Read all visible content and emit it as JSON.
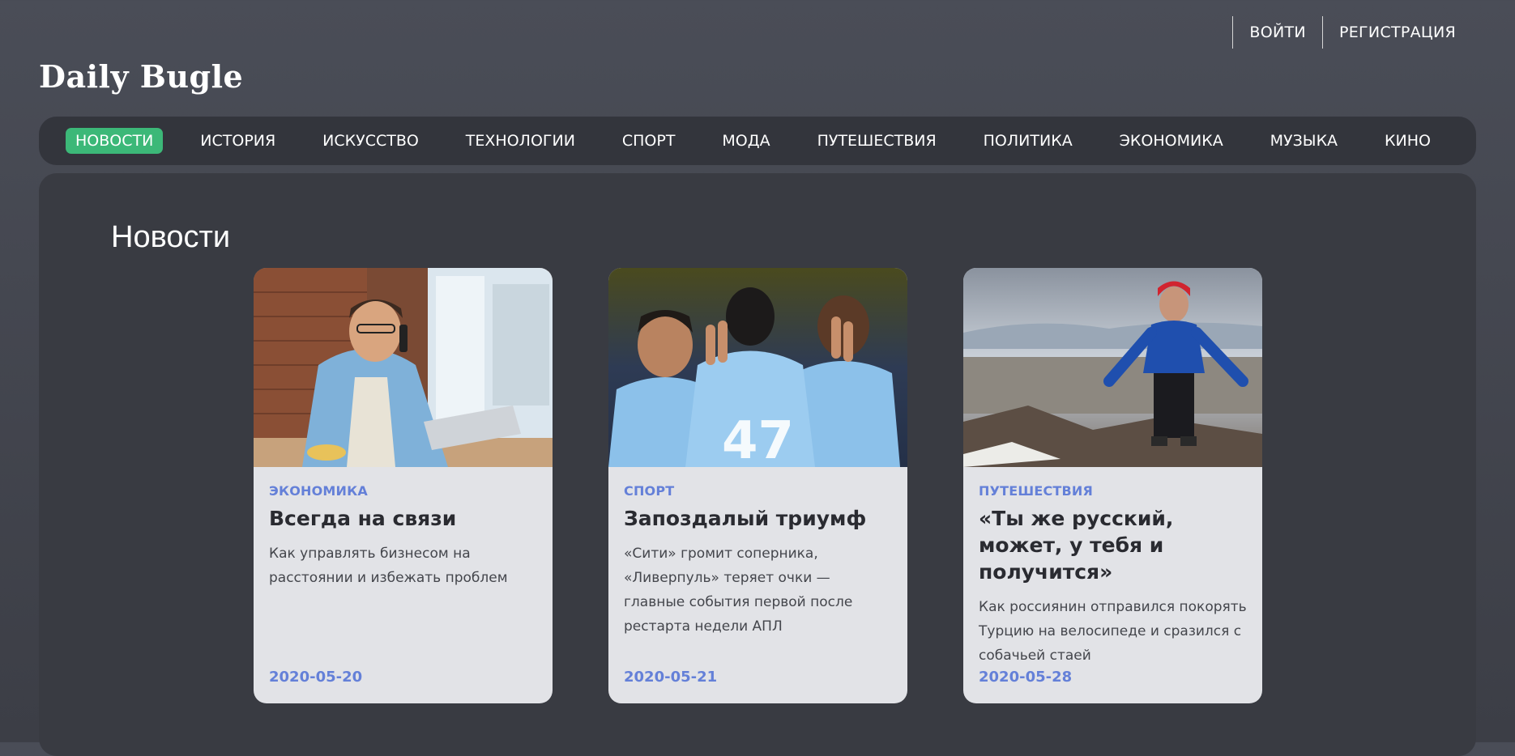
{
  "header": {
    "logo": "Daily Bugle",
    "login_label": "ВОЙТИ",
    "register_label": "РЕГИСТРАЦИЯ"
  },
  "nav": {
    "items": [
      {
        "label": "НОВОСТИ",
        "active": true
      },
      {
        "label": "ИСТОРИЯ"
      },
      {
        "label": "ИСКУССТВО"
      },
      {
        "label": "ТЕХНОЛОГИИ"
      },
      {
        "label": "СПОРТ"
      },
      {
        "label": "МОДА"
      },
      {
        "label": "ПУТЕШЕСТВИЯ"
      },
      {
        "label": "ПОЛИТИКА"
      },
      {
        "label": "ЭКОНОМИКА"
      },
      {
        "label": "МУЗЫКА"
      },
      {
        "label": "КИНО"
      }
    ],
    "active_color": "#3cb878"
  },
  "main": {
    "section_title": "Новости",
    "cards": [
      {
        "category": "ЭКОНОМИКА",
        "title": "Всегда на связи",
        "description": "Как управлять бизнесом на расстоянии и избежать проблем",
        "date": "2020-05-20",
        "image_icon": "businessman-photo-icon"
      },
      {
        "category": "СПОРТ",
        "title": "Запоздалый триумф",
        "description": "«Сити» громит соперника, «Ливерпуль» теряет очки — главные события первой после рестарта недели АПЛ",
        "date": "2020-05-21",
        "image_icon": "football-players-photo-icon"
      },
      {
        "category": "ПУТЕШЕСТВИЯ",
        "title": "«Ты же русский, может, у тебя и получится»",
        "description": "Как россиянин отправился покорять Турцию на велосипеде и сразился с собачьей стаей",
        "date": "2020-05-28",
        "image_icon": "mountain-traveler-photo-icon"
      }
    ]
  },
  "colors": {
    "accent": "#6480d8",
    "card_background": "#e2e3e7",
    "nav_background": "#33353c"
  }
}
